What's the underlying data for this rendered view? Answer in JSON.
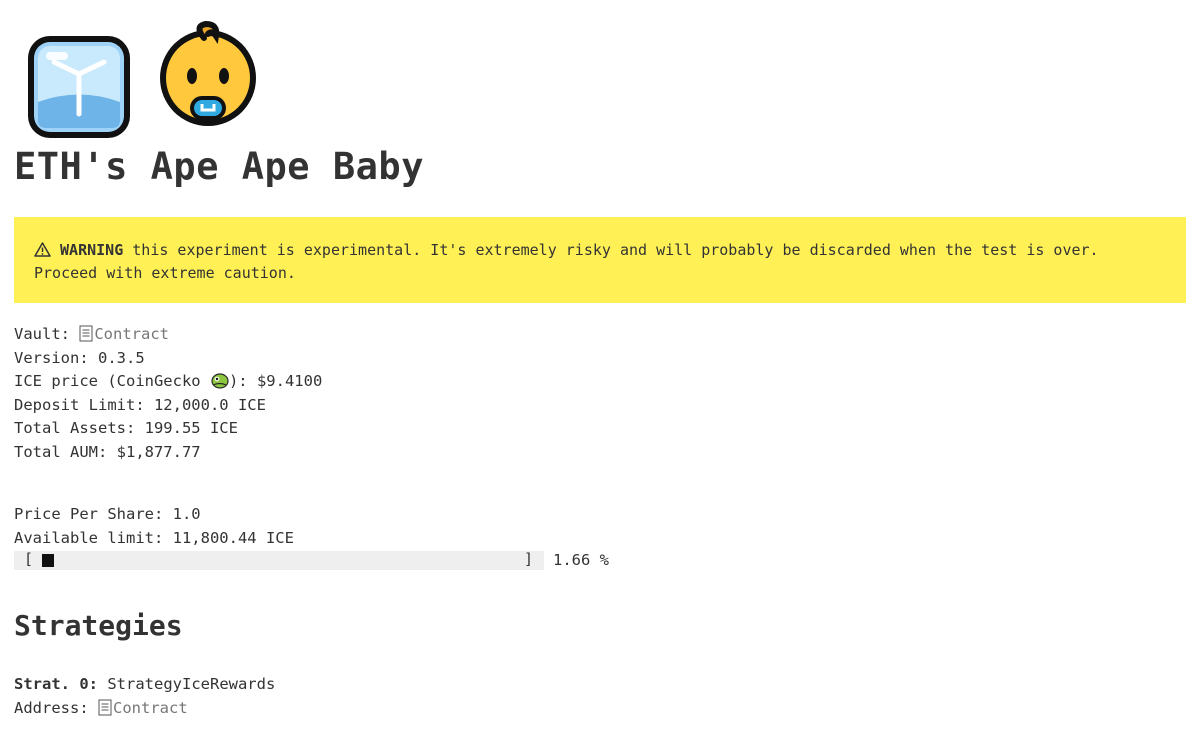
{
  "header": {
    "icons": [
      "ice-cube-icon",
      "baby-face-icon"
    ],
    "title": "ETH's Ape Ape Baby"
  },
  "warning": {
    "icon": "warning-icon",
    "label": "WARNING",
    "text": " this experiment is experimental. It's extremely risky and will probably be discarded when the test is over. Proceed with extreme caution.",
    "background": "#fff155"
  },
  "vault": {
    "vault_label": "Vault: ",
    "contract_link": "Contract",
    "version": "Version: 0.3.5",
    "price_prefix": "ICE price (CoinGecko ",
    "price_suffix": "): $9.4100",
    "deposit_limit": "Deposit Limit: 12,000.0 ICE",
    "total_assets": "Total Assets: 199.55 ICE",
    "total_aum": "Total AUM: $1,877.77"
  },
  "shares": {
    "price_per_share": "Price Per Share: 1.0",
    "available_limit": "Available limit: 11,800.44 ICE",
    "progress_left": "[",
    "progress_right": "]",
    "progress_percent_text": "1.66 %",
    "progress_fraction": 0.0166
  },
  "strategies": {
    "heading": "Strategies",
    "items": [
      {
        "index_label": "Strat. 0:",
        "name": " StrategyIceRewards",
        "address_label": "Address: ",
        "contract_link": "Contract"
      }
    ]
  }
}
